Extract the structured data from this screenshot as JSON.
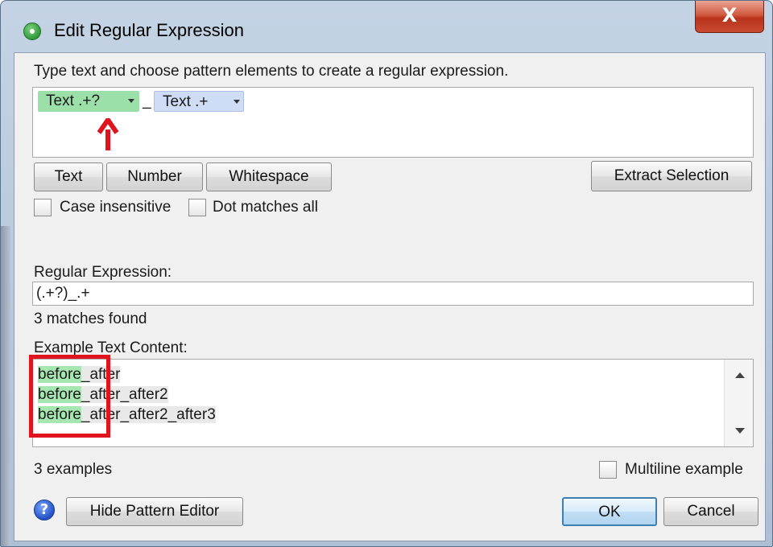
{
  "window": {
    "title": "Edit Regular Expression",
    "close_label": "X"
  },
  "instructions": "Type text and choose pattern elements to create a regular expression.",
  "pattern": {
    "chips": [
      {
        "label": "Text .+?",
        "color": "#9be0a8"
      },
      {
        "label": "Text .+",
        "color": "#cfdcf5"
      }
    ],
    "separator": "_"
  },
  "element_buttons": {
    "text": "Text",
    "number": "Number",
    "whitespace": "Whitespace",
    "extract_selection": "Extract Selection"
  },
  "options": {
    "case_insensitive": {
      "label": "Case insensitive",
      "checked": false
    },
    "dot_matches_all": {
      "label": "Dot matches all",
      "checked": false
    }
  },
  "regex": {
    "label": "Regular Expression:",
    "value": "(.+?)_.+",
    "status": "3 matches found"
  },
  "example": {
    "label": "Example Text Content:",
    "lines": [
      {
        "match": "before",
        "rest": "_after"
      },
      {
        "match": "before",
        "rest": "_after_after2"
      },
      {
        "match": "before",
        "rest": "_after_after2_after3"
      }
    ],
    "count_text": "3 examples",
    "multiline_label": "Multiline example"
  },
  "footer": {
    "help_icon": "?",
    "hide_pattern_editor": "Hide Pattern Editor",
    "ok": "OK",
    "cancel": "Cancel"
  },
  "colors": {
    "match_highlight": "#a6e6b0",
    "annotation_red": "#e0141e"
  }
}
